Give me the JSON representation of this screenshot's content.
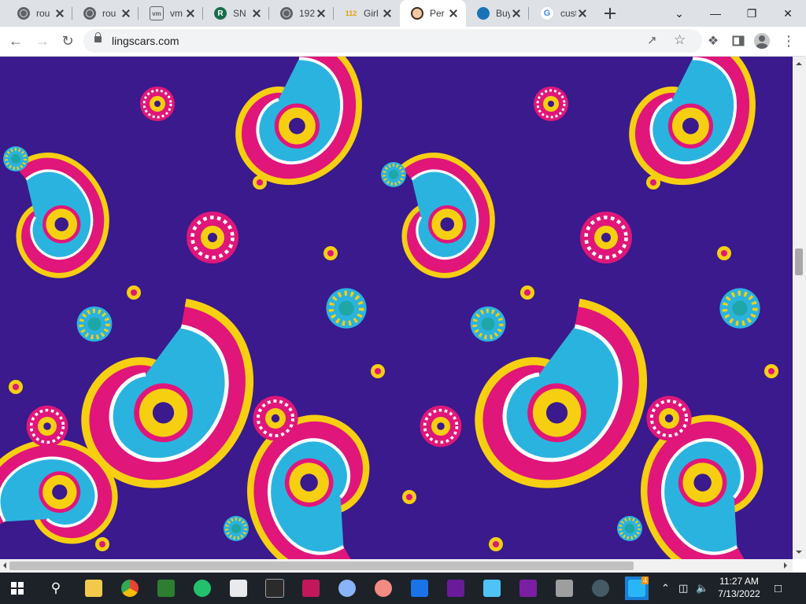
{
  "browser": {
    "tabs": [
      {
        "title": "rou",
        "icon": "globe-icon",
        "active": false
      },
      {
        "title": "rou",
        "icon": "globe-icon",
        "active": false
      },
      {
        "title": "vm",
        "icon": "vm-icon",
        "active": false
      },
      {
        "title": "SN",
        "icon": "r-logo-icon",
        "active": false
      },
      {
        "title": "192",
        "icon": "globe-icon",
        "active": false
      },
      {
        "title": "Girl",
        "icon": "112-logo-icon",
        "active": false
      },
      {
        "title": "Per",
        "icon": "face-avatar-icon",
        "active": true
      },
      {
        "title": "Buy",
        "icon": "buy-logo-icon",
        "active": false
      },
      {
        "title": "custom",
        "icon": "google-icon",
        "active": false
      }
    ],
    "url": "lingscars.com"
  },
  "page": {
    "background_pattern": "paisley",
    "colors": {
      "base": "#3a1a8c",
      "magenta": "#e0167a",
      "cyan": "#2bb3e0",
      "yellow": "#f7cf11",
      "teal": "#1fa6a6",
      "white": "#ffffff"
    }
  },
  "taskbar": {
    "time": "11:27 AM",
    "date": "7/13/2022",
    "apps": [
      "search-icon",
      "file-explorer-icon",
      "chrome-icon",
      "spreadsheet-icon",
      "sync-app-icon",
      "photos-icon",
      "terminal-icon",
      "paint-icon",
      "palette-icon",
      "design-icon",
      "remote-icon",
      "terminal2-icon",
      "notepad-icon",
      "media-icon",
      "gnome-icon",
      "person-icon",
      "app-icon"
    ],
    "badge_count": "4"
  }
}
